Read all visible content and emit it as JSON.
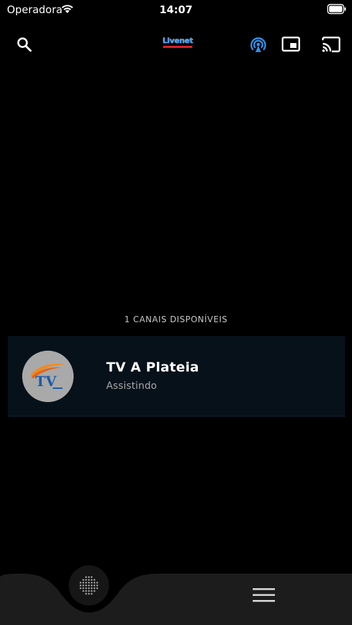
{
  "status_bar": {
    "carrier": "Operadora",
    "time": "14:07"
  },
  "toolbar": {
    "logo_text": "Livenet",
    "icons": [
      "search-icon",
      "radio-tower-icon",
      "picture-in-picture-icon",
      "cast-icon"
    ]
  },
  "channels": {
    "count_label": "1 CANAIS DISPONÍVEIS",
    "items": [
      {
        "name": "TV A Plateia",
        "status": "Assistindo",
        "logo_text": "TV"
      }
    ]
  },
  "bottom_nav": {
    "icons": [
      "dialpad-icon",
      "hamburger-menu-icon"
    ]
  },
  "colors": {
    "background": "#000000",
    "card": "#07111a",
    "accent": "#4aa3ff",
    "bottom_bar": "#1c1c1c"
  }
}
